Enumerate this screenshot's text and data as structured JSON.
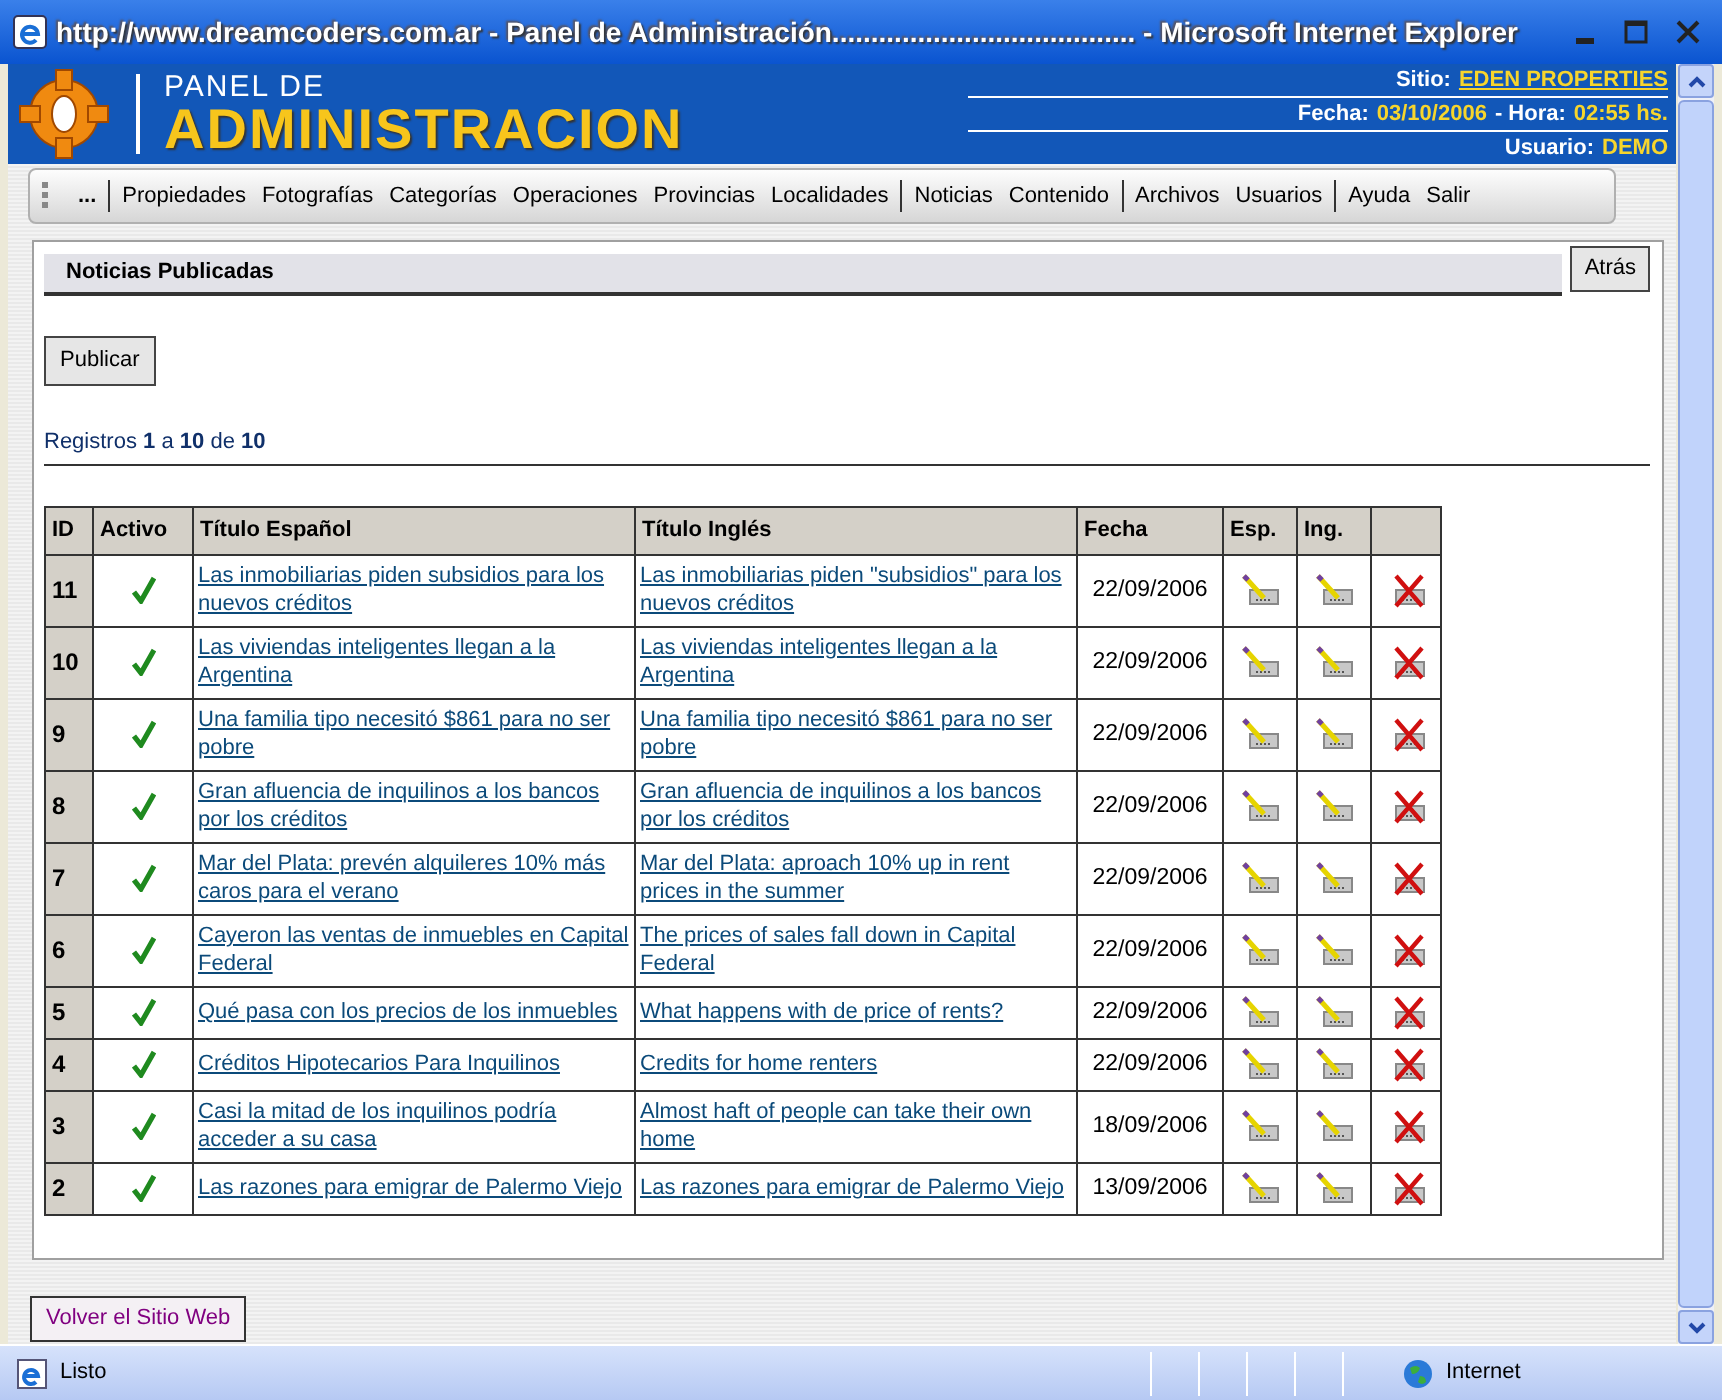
{
  "window": {
    "title": "http://www.dreamcoders.com.ar - Panel de Administración....................................... - Microsoft Internet Explorer"
  },
  "header": {
    "title_small": "PANEL DE",
    "title_large": "ADMINISTRACION",
    "site_label": "Sitio:",
    "site_value": "EDEN PROPERTIES",
    "date_label": "Fecha:",
    "date_value": "03/10/2006",
    "time_label": "- Hora:",
    "time_value": "02:55 hs.",
    "user_label": "Usuario:",
    "user_value": "DEMO"
  },
  "menu": {
    "groups": [
      [
        "..."
      ],
      [
        "Propiedades",
        "Fotografías",
        "Categorías",
        "Operaciones",
        "Provincias",
        "Localidades"
      ],
      [
        "Noticias",
        "Contenido"
      ],
      [
        "Archivos",
        "Usuarios"
      ],
      [
        "Ayuda",
        "Salir"
      ]
    ]
  },
  "section_title": "Noticias Publicadas",
  "back_button": "Atrás",
  "publish_button": "Publicar",
  "records": "Registros **1** a **10** de **10**",
  "table": {
    "columns": [
      "ID",
      "Activo",
      "Título Español",
      "Título Inglés",
      "Fecha",
      "Esp.",
      "Ing."
    ],
    "rows": [
      {
        "id": "11",
        "active": true,
        "title_es": "Las inmobiliarias piden subsidios para los nuevos créditos",
        "title_en": "Las inmobiliarias piden \"subsidios\" para los nuevos créditos",
        "date": "22/09/2006"
      },
      {
        "id": "10",
        "active": true,
        "title_es": "Las viviendas inteligentes llegan a la Argentina",
        "title_en": "Las viviendas inteligentes llegan a la Argentina",
        "date": "22/09/2006"
      },
      {
        "id": "9",
        "active": true,
        "title_es": "Una familia tipo necesitó $861 para no ser pobre",
        "title_en": "Una familia tipo necesitó $861 para no ser pobre",
        "date": "22/09/2006"
      },
      {
        "id": "8",
        "active": true,
        "title_es": "Gran afluencia de inquilinos a los bancos por los créditos",
        "title_en": "Gran afluencia de inquilinos a los bancos por los créditos",
        "date": "22/09/2006"
      },
      {
        "id": "7",
        "active": true,
        "title_es": "Mar del Plata: prevén alquileres 10% más caros para el verano",
        "title_en": "Mar del Plata: aproach 10% up in rent prices in the summer",
        "date": "22/09/2006"
      },
      {
        "id": "6",
        "active": true,
        "title_es": "Cayeron las ventas de inmuebles en Capital Federal",
        "title_en": "The prices of sales fall down in Capital Federal",
        "date": "22/09/2006"
      },
      {
        "id": "5",
        "active": true,
        "title_es": "Qué pasa con los precios de los inmuebles",
        "title_en": "What happens with de price of rents?",
        "date": "22/09/2006"
      },
      {
        "id": "4",
        "active": true,
        "title_es": "Créditos Hipotecarios Para Inquilinos",
        "title_en": "Credits for home renters",
        "date": "22/09/2006"
      },
      {
        "id": "3",
        "active": true,
        "title_es": "Casi la mitad de los inquilinos podría acceder a su casa",
        "title_en": "Almost haft of people can take their own home",
        "date": "18/09/2006"
      },
      {
        "id": "2",
        "active": true,
        "title_es": "Las razones para emigrar de Palermo Viejo",
        "title_en": "Las razones para emigrar de Palermo Viejo",
        "date": "13/09/2006"
      }
    ]
  },
  "footer_button": "Volver el Sitio Web",
  "status_bar": {
    "text": "Listo",
    "zone": "Internet"
  }
}
